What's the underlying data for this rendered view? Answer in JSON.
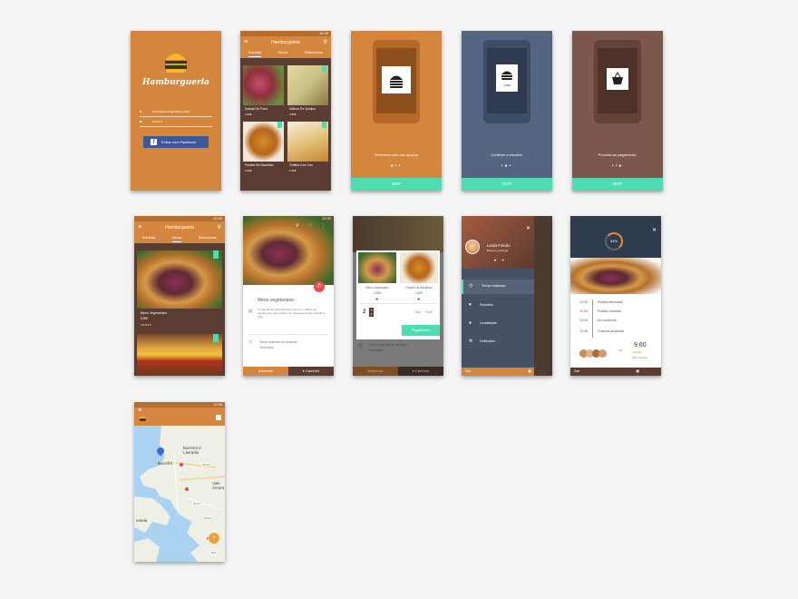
{
  "status_time": "12:30",
  "app_name": "Hamburgueria",
  "login": {
    "email_placeholder": "LINDAFALCAO@GMAIL.COM",
    "password_placeholder": "••••••••",
    "facebook_button": "Entrar com Facebook"
  },
  "menu_screen": {
    "tabs": [
      "Entradas",
      "Menus",
      "Sobremesas"
    ],
    "items": [
      {
        "name": "Salada De Polvo",
        "price": "2,50€"
      },
      {
        "name": "Mistura De Queijos",
        "price": "3,50€"
      },
      {
        "name": "Pastéis De Bacalhau",
        "price": "3,50€"
      },
      {
        "name": "Tortilha Com Ovo",
        "price": "1,50€"
      }
    ]
  },
  "onboarding": [
    {
      "caption": "Seleciona uma das opções",
      "color": "#d5863e",
      "phone": "#b46a26"
    },
    {
      "caption": "Confirme a escolha.",
      "color": "#536580",
      "phone": "#3d4d66",
      "price": "3,99€"
    },
    {
      "caption": "Proceda ao pagamento.",
      "color": "#7d574d",
      "phone": "#654238"
    }
  ],
  "skip_label": "SKIP",
  "menus_screen": {
    "item_name": "Menu Vegetariano",
    "item_price": "5,99€"
  },
  "detail": {
    "title": "Menu vegetariano",
    "description": "O ingrediente especial deste menu é o abrigo da cebola roxa, que confere um toque levemente frutado a este.",
    "time_label": "Tempo estimado de confecão",
    "time_value": "15 minutos",
    "add_button": "Adicionar",
    "cart_button": "Carrinho"
  },
  "cart": {
    "items": [
      {
        "name": "Menu Vegetariano",
        "price": "5,99€"
      },
      {
        "name": "Pastéis de Bacalhau",
        "price": "3,50€"
      }
    ],
    "qty": "2",
    "total_label": "Total",
    "total_value": "9,49€",
    "pay_button": "Pagamento",
    "time_label": "Tempo estimado de confecão",
    "time_value": "15 minutos",
    "add_button": "Adicionar",
    "cart_button": "Carrinho"
  },
  "drawer": {
    "user_name": "Linda Falcão",
    "user_sub": "Barreiro, portugal",
    "items": [
      "Tempo estimado",
      "Favoritos",
      "Localização",
      "Definições"
    ],
    "exit": "Sair"
  },
  "tracking": {
    "percent": "54%",
    "steps": [
      {
        "time": "12:20",
        "label": "Pedido efectuado"
      },
      {
        "time": "12:23",
        "label": "Pedido recebido"
      },
      {
        "time": "12:25",
        "label": "Em confecão"
      },
      {
        "time": "12:36",
        "label": "Cozinha pendente"
      }
    ],
    "count": "+18",
    "rating": "9.60",
    "rating_sub": "(250 ratings)",
    "exit": "Sair"
  },
  "map": {
    "labels": [
      "Barreiro e Lavradio",
      "Barreiro",
      "Vale Amore",
      "Paiha",
      "entela"
    ],
    "roads": [
      "N10-3",
      "N10-3",
      "N10-3",
      "N11"
    ]
  },
  "colors": {
    "orange": "#d5863e",
    "dark": "#5a3c32",
    "teal": "#4fdcb2",
    "red": "#ec4a4f",
    "slate": "#465264",
    "fb": "#3b5998"
  }
}
